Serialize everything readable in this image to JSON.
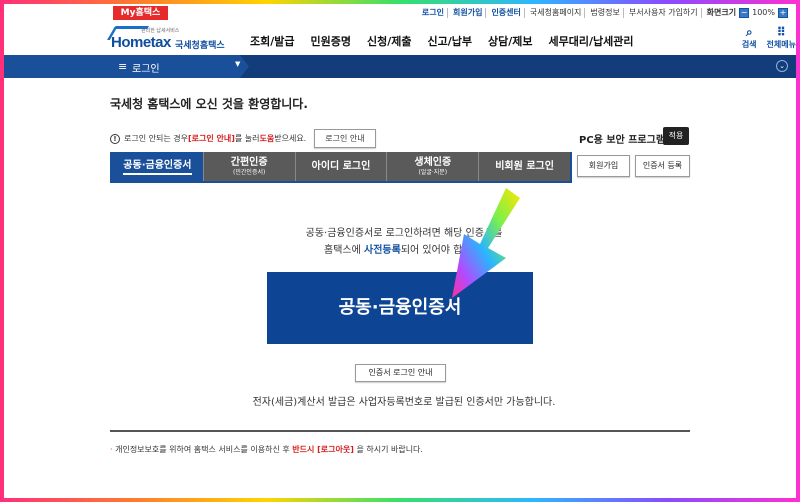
{
  "utility": {
    "my_hometax": "My홈택스",
    "links": [
      "로그인",
      "회원가입",
      "인증센터",
      "국세청홈페이지",
      "법령정보",
      "부서사용자 가입하기"
    ],
    "screen_size_label": "화면크기",
    "zoom": "100%"
  },
  "logo": {
    "tagline": "편리한 납세서비스",
    "brand": "Hometax",
    "org": "국세청홈택스"
  },
  "gnb": [
    "조회/발급",
    "민원증명",
    "신청/제출",
    "신고/납부",
    "상담/제보",
    "세무대리/납세관리"
  ],
  "header_icons": {
    "search": "검색",
    "all_menu": "전체메뉴"
  },
  "nav": {
    "current": "로그인"
  },
  "welcome": "국세청 홈택스에 오신 것을 환영합니다.",
  "info": {
    "pre": "로그인 안되는 경우 ",
    "highlight": "[로그인 안내]",
    "mid": "를 눌러 ",
    "help": "도움",
    "post": "받으세요.",
    "button": "로그인 안내"
  },
  "pc_security": {
    "label": "PC용 보안 프로그램",
    "apply": "적용"
  },
  "tabs": [
    {
      "label": "공동·금융인증서",
      "sub": ""
    },
    {
      "label": "간편인증",
      "sub": "(민간인증서)"
    },
    {
      "label": "아이디 로그인",
      "sub": ""
    },
    {
      "label": "생체인증",
      "sub": "(얼굴·지문)"
    },
    {
      "label": "비회원 로그인",
      "sub": ""
    }
  ],
  "side_buttons": {
    "join": "회원가입",
    "cert_register": "인증서 등록"
  },
  "desc": {
    "line1": "공동·금융인증서로 로그인하려면 해당 인증서를",
    "line2_pre": "홈택스에 ",
    "line2_b": "사전등록",
    "line2_post": "되어 있어야 합니다."
  },
  "cert_button": "공동·금융인증서",
  "cert_guide": "인증서 로그인 안내",
  "note": "전자(세금)계산서 발급은 사업자등록번호로 발급된 인증서만 가능합니다.",
  "privacy": {
    "pre": "개인정보보호를 위하여 홈택스 서비스를 이용하신 후 ",
    "bold1": "반드시 [로그아웃]",
    "post": "을 하시기 바랍니다."
  },
  "colors": {
    "brand": "#0d4594",
    "nav": "#123c7a",
    "accent_red": "#d42020",
    "tab_inactive": "#5a5a5a"
  }
}
